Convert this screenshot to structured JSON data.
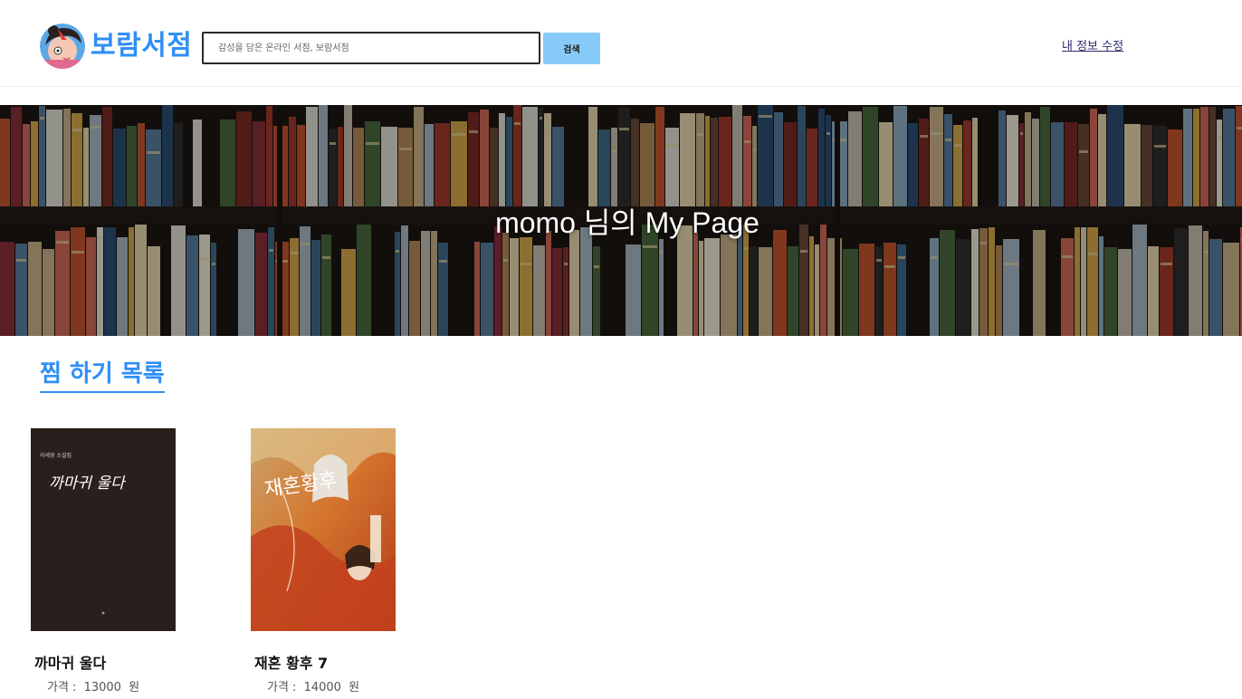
{
  "header": {
    "logo_text": "보람서점",
    "search_placeholder": "감성을 담은 온라인 서점, 보람서점",
    "search_button": "검색",
    "profile_link": "내 정보 수정",
    "brand_color": "#2f8ff5",
    "button_color": "#86cbf8"
  },
  "hero": {
    "title": "momo 님의 My Page"
  },
  "wishlist": {
    "title": "찜 하기 목록",
    "books": [
      {
        "title": "까마귀 울다",
        "price_label": "가격 :",
        "price": "13000",
        "unit": "원",
        "cover_text": "까마귀 울다",
        "cover_author": "이세영 소설집",
        "cover_icon": "dark-book-cover"
      },
      {
        "title": "재혼 황후 7",
        "price_label": "가격 :",
        "price": "14000",
        "unit": "원",
        "cover_text": "재혼황후",
        "cover_icon": "illustrated-book-cover"
      }
    ]
  }
}
